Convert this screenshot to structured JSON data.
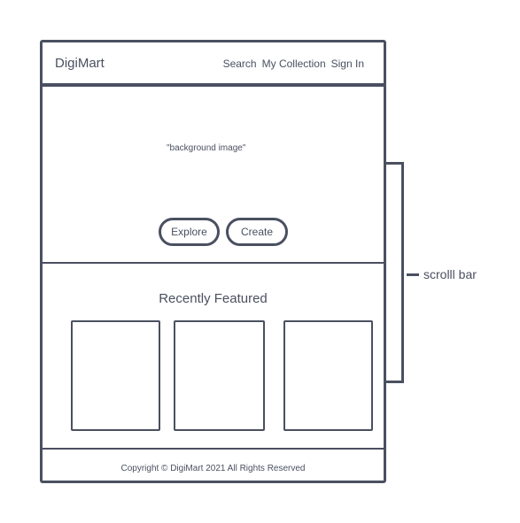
{
  "navbar": {
    "brand": "DigiMart",
    "links": [
      "Search",
      "My Collection",
      "Sign In"
    ]
  },
  "hero": {
    "caption": "\"background image\"",
    "buttons": {
      "explore": "Explore",
      "create": "Create"
    }
  },
  "featured": {
    "title": "Recently Featured",
    "card_count": 3
  },
  "footer": {
    "text": "Copyright © DigiMart 2021 All Rights Reserved"
  },
  "annotation": {
    "label": "scrolll bar"
  }
}
